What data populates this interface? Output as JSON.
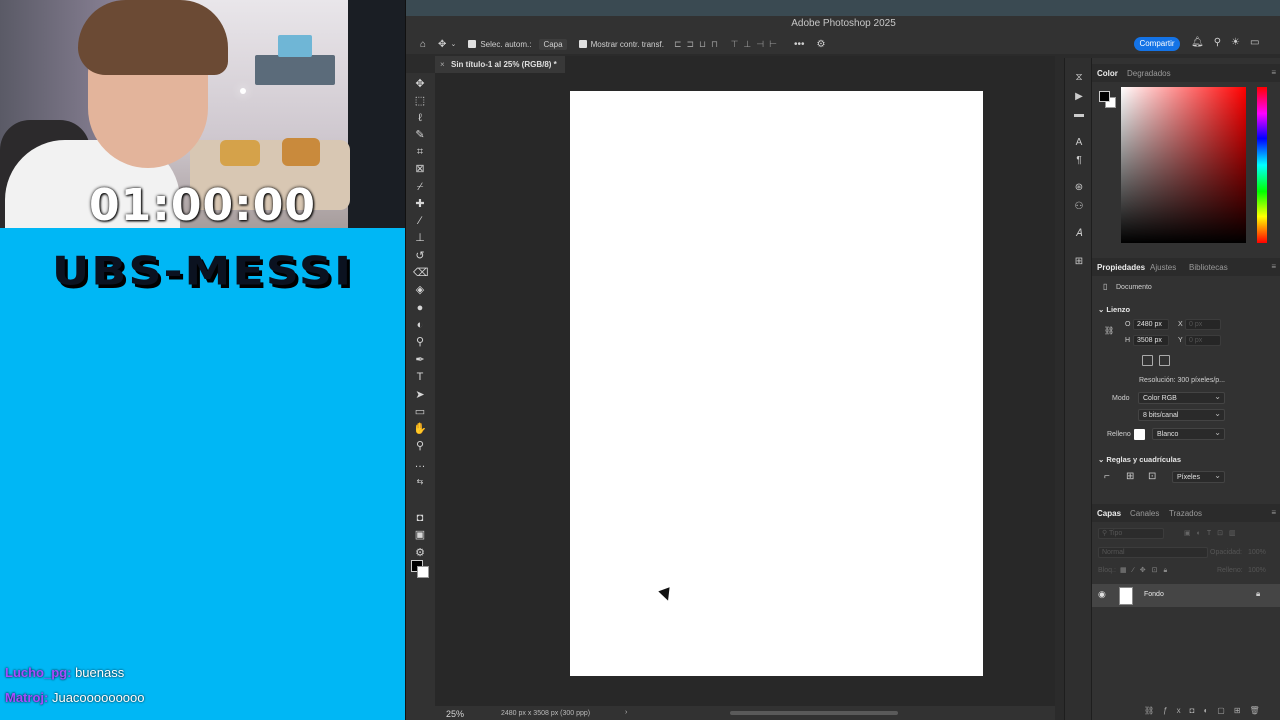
{
  "stream": {
    "timer": "01:00:00",
    "title": "UBS-MESSI",
    "chat": [
      {
        "user": "Lucho_pg:",
        "message": "buenass",
        "user_color": "#a64cff"
      },
      {
        "user": "Matroj:",
        "message": "Juacooooooooo",
        "user_color": "#a64cff"
      }
    ]
  },
  "photoshop": {
    "app_title": "Adobe Photoshop 2025",
    "options_bar": {
      "auto_select_label": "Selec. autom.:",
      "auto_select_value": "Capa",
      "show_transform_label": "Mostrar contr. transf."
    },
    "share_button": "Compartir",
    "document_tab": "Sin título-1 al 25% (RGB/8) *",
    "status": {
      "zoom": "25%",
      "info": "2480 px x 3508 px (300 ppp)",
      "arrow": "›"
    },
    "color_panel": {
      "tabs": [
        "Color",
        "Degradados"
      ],
      "foreground": "#000000",
      "background": "#ffffff"
    },
    "properties_panel": {
      "tabs": [
        "Propiedades",
        "Ajustes",
        "Bibliotecas"
      ],
      "section": "Documento",
      "canvas_heading": "Lienzo",
      "width_label": "O",
      "width_value": "2480 px",
      "x_label": "X",
      "x_placeholder": "0 px",
      "height_label": "H",
      "height_value": "3508 px",
      "y_label": "Y",
      "y_placeholder": "0 px",
      "resolution": "Resolución: 300 píxeles/p...",
      "mode_label": "Modo",
      "mode_value": "Color RGB",
      "bits_value": "8 bits/canal",
      "fill_label": "Relleno",
      "fill_value": "Blanco",
      "rulers_heading": "Reglas y cuadrículas",
      "units_value": "Píxeles"
    },
    "layers_panel": {
      "tabs": [
        "Capas",
        "Canales",
        "Trazados"
      ],
      "search_placeholder": "Tipo",
      "blend_mode": "Normal",
      "opacity_label": "Opacidad:",
      "opacity_value": "100%",
      "lock_label": "Bloq.:",
      "fill_label": "Relleno:",
      "fill_value": "100%",
      "layers": [
        {
          "name": "Fondo",
          "visible": true,
          "locked": true
        }
      ]
    }
  }
}
